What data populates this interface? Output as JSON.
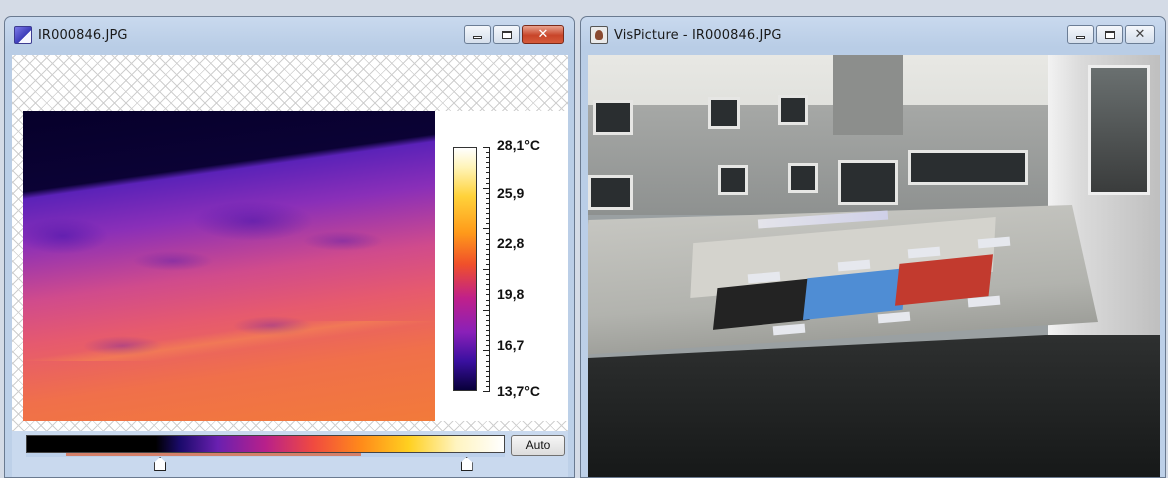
{
  "ir_window": {
    "title": "IR000846.JPG",
    "icon": "thermal-app-icon",
    "buttons": {
      "minimize": "minimize",
      "maximize": "maximize",
      "close": "close"
    },
    "temperature_scale": {
      "labels": [
        "28,1°C",
        "25,9",
        "22,8",
        "19,8",
        "16,7",
        "13,7°C"
      ],
      "max": "28,1°C",
      "min": "13,7°C"
    },
    "palette_bar": {
      "auto_label": "Auto",
      "range_low_fraction": 0.28,
      "range_high_fraction": 0.92
    }
  },
  "vis_window": {
    "title": "VisPicture - IR000846.JPG",
    "icon": "picture-app-icon"
  }
}
